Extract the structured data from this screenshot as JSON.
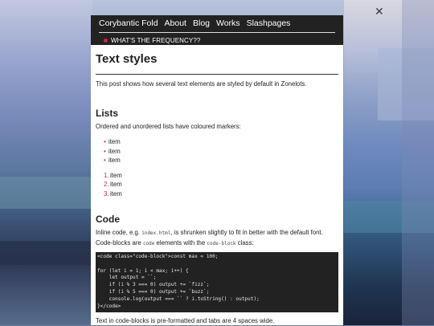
{
  "nav": {
    "items": [
      "Corybantic Fold",
      "About",
      "Blog",
      "Works",
      "Slashpages"
    ],
    "banner": "WHAT'S THE FREQUENCY??"
  },
  "post": {
    "title": "Text styles",
    "intro": "This post shows how several text elements are styled by default in Zonelots."
  },
  "lists": {
    "heading": "Lists",
    "lead": "Ordered and unordered lists have coloured markers:",
    "unordered": [
      "item",
      "item",
      "item"
    ],
    "ordered": [
      "item",
      "item",
      "item"
    ]
  },
  "code": {
    "heading": "Code",
    "lead_a": "Inline code, e.g. ",
    "inline_example": "index.html",
    "lead_b": ", is shrunken slightly to fit in better with the default font. Code-blocks are ",
    "inline_code": "code",
    "lead_c": " elements with the ",
    "inline_class": "code-block",
    "lead_d": " class:",
    "block": "<code class=\"code-block\">const max = 100;\n\nfor (let i = 1; i < max; i++) {\n    let output = ``;\n    if (i % 3 === 0) output += `fizz`;\n    if (i % 5 === 0) output += `buzz`;\n    console.log(output === `` ? i.toString() : output);\n}</code>",
    "after": "Text in code-blocks is pre-formatted and tabs are 4 spaces wide."
  },
  "colors": {
    "marker": "#d0263a",
    "topbar": "#222222"
  }
}
